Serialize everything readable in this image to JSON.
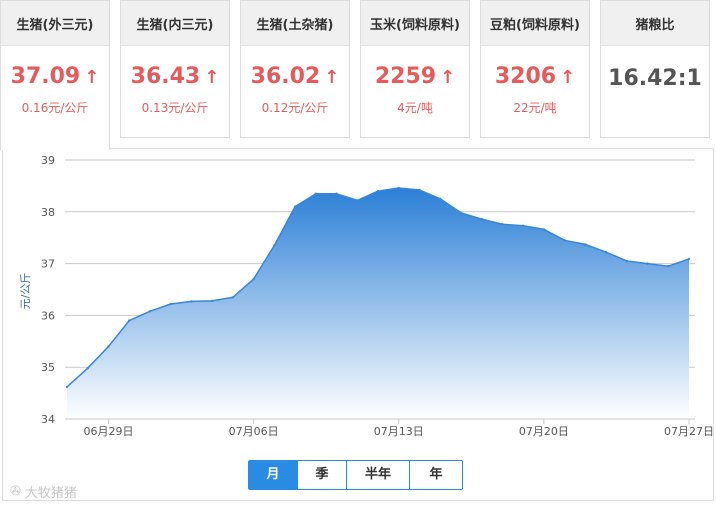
{
  "cards": [
    {
      "title": "生猪(外三元)",
      "value": "37.09",
      "arrow": "↑",
      "change": "0.16元/公斤"
    },
    {
      "title": "生猪(内三元)",
      "value": "36.43",
      "arrow": "↑",
      "change": "0.13元/公斤"
    },
    {
      "title": "生猪(土杂猪)",
      "value": "36.02",
      "arrow": "↑",
      "change": "0.12元/公斤"
    },
    {
      "title": "玉米(饲料原料)",
      "value": "2259",
      "arrow": "↑",
      "change": "4元/吨"
    },
    {
      "title": "豆粕(饲料原料)",
      "value": "3206",
      "arrow": "↑",
      "change": "22元/吨"
    },
    {
      "title": "猪粮比",
      "value": "16.42:1"
    }
  ],
  "colors": {
    "up": "#e85a5a",
    "accent": "#2a8be3",
    "line": "#3a86d8"
  },
  "period_toggle": {
    "month": "月",
    "quarter": "季",
    "half_year": "半年",
    "year": "年",
    "selected": "月"
  },
  "watermark": "大牧猪猪",
  "chart_data": {
    "type": "area",
    "ylabel": "元/公斤",
    "ylim": [
      34,
      39
    ],
    "yticks": [
      34,
      35,
      36,
      37,
      38,
      39
    ],
    "xticks": [
      "06月29日",
      "07月06日",
      "07月13日",
      "07月20日",
      "07月27日"
    ],
    "grid": true,
    "x": [
      "06-27",
      "06-28",
      "06-29",
      "06-30",
      "07-01",
      "07-02",
      "07-03",
      "07-04",
      "07-05",
      "07-06",
      "07-07",
      "07-08",
      "07-09",
      "07-10",
      "07-11",
      "07-12",
      "07-13",
      "07-14",
      "07-15",
      "07-16",
      "07-17",
      "07-18",
      "07-19",
      "07-20",
      "07-21",
      "07-22",
      "07-23",
      "07-24",
      "07-25",
      "07-26",
      "07-27"
    ],
    "values": [
      34.62,
      34.98,
      35.4,
      35.9,
      36.08,
      36.22,
      36.27,
      36.28,
      36.35,
      36.7,
      37.35,
      38.1,
      38.35,
      38.35,
      38.22,
      38.4,
      38.46,
      38.42,
      38.25,
      37.98,
      37.86,
      37.76,
      37.73,
      37.66,
      37.45,
      37.37,
      37.22,
      37.05,
      37.0,
      36.95,
      37.09
    ]
  }
}
